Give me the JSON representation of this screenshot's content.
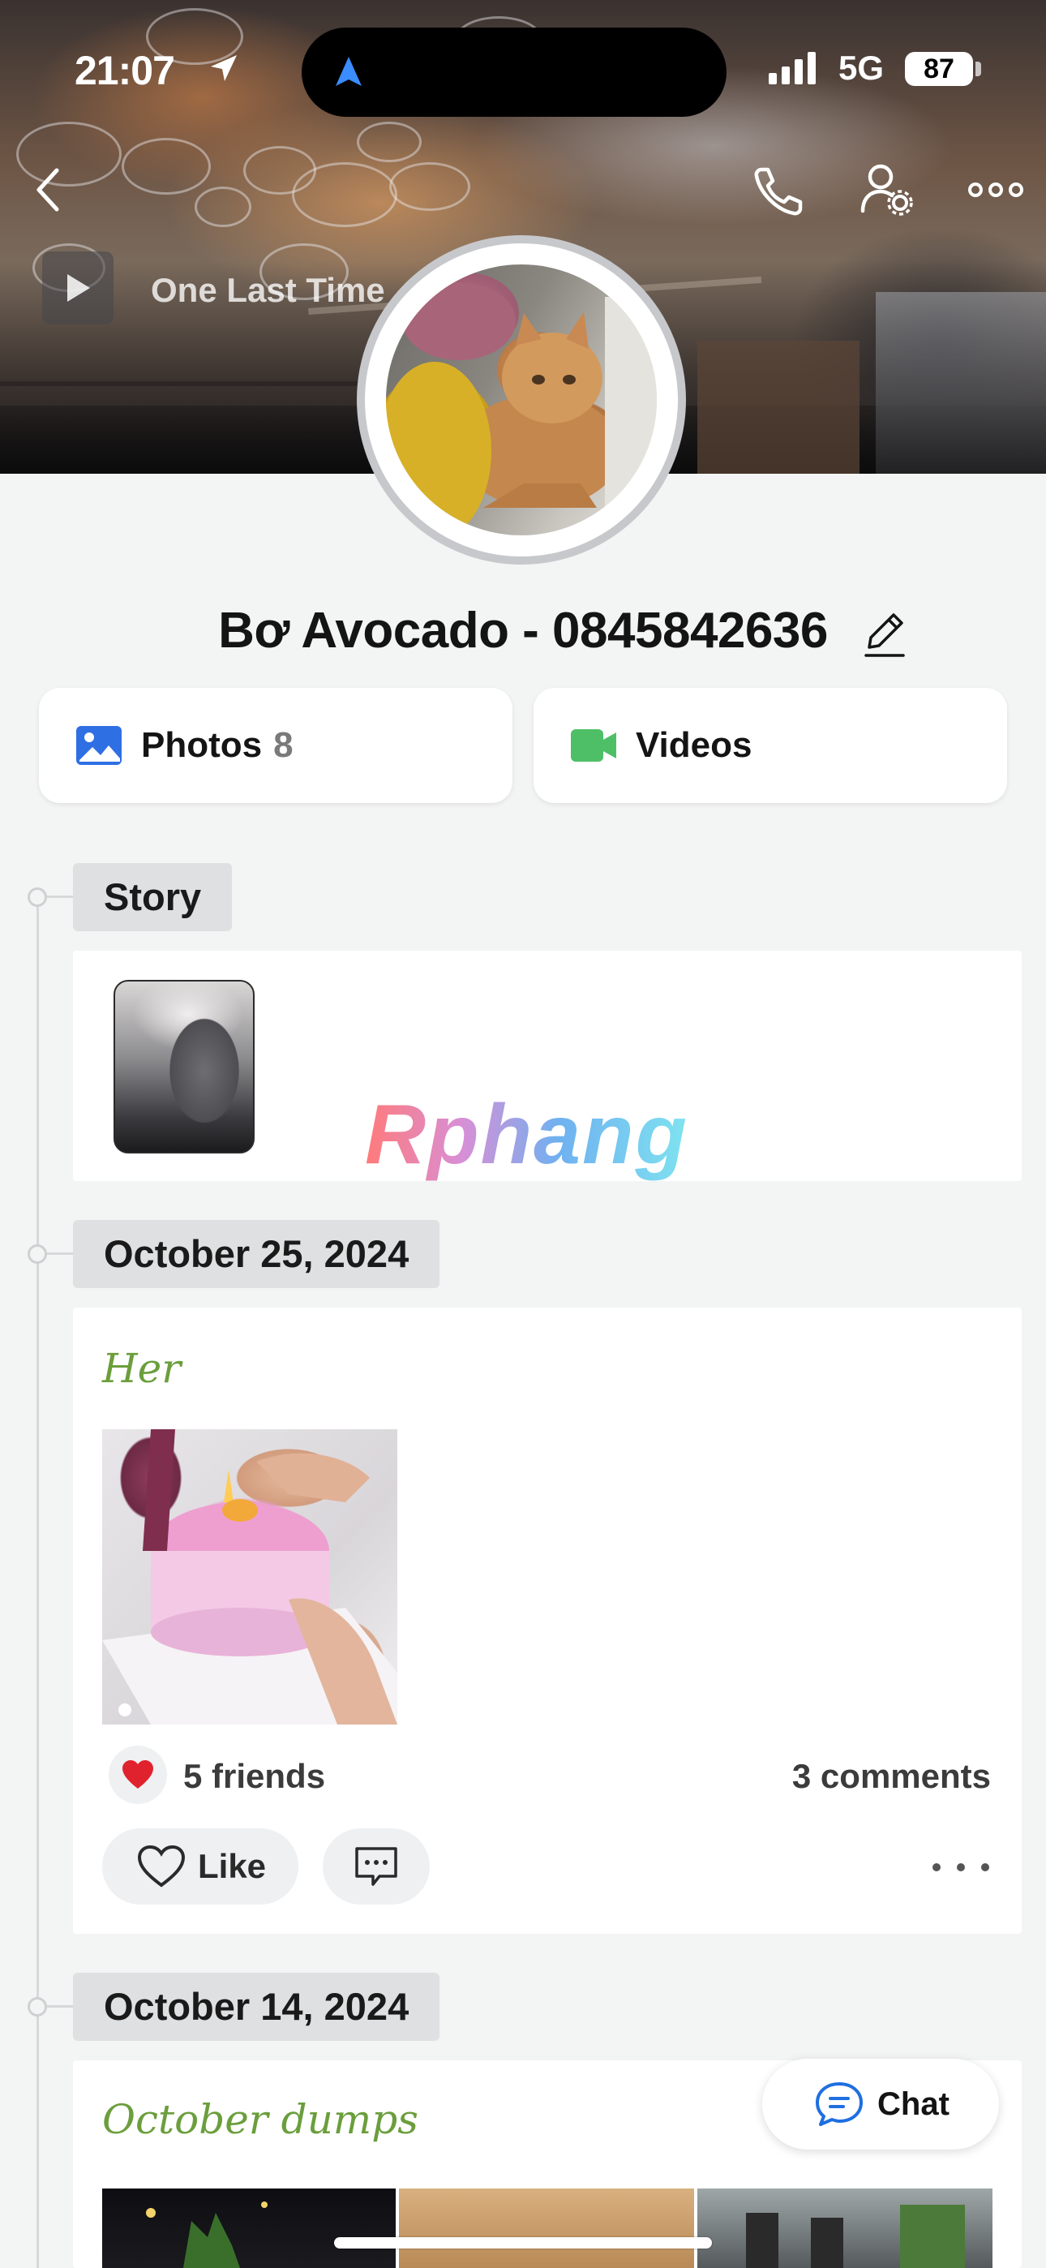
{
  "status_bar": {
    "time": "21:07",
    "network": "5G",
    "battery": "87"
  },
  "cover": {
    "music_title": "One Last Time"
  },
  "profile": {
    "name": "Bơ Avocado - 0845842636"
  },
  "media": {
    "photos_label": "Photos",
    "photos_count": "8",
    "videos_label": "Videos",
    "photos_icon_color": "#2f6fe4",
    "videos_icon_color": "#4fbf67"
  },
  "timeline": {
    "story": {
      "label": "Story",
      "watermark": "Rphang"
    },
    "posts": [
      {
        "date": "October 25, 2024",
        "title": "Her",
        "reactions": "5 friends",
        "comments": "3 comments",
        "like_label": "Like"
      },
      {
        "date": "October 14, 2024",
        "title": "October dumps"
      }
    ]
  },
  "chat": {
    "label": "Chat"
  },
  "colors": {
    "accent_title_green": "#6b9e3c",
    "background": "#f3f4f4",
    "chat_icon_blue": "#1f6fe0",
    "heart_red": "#e0222e"
  }
}
